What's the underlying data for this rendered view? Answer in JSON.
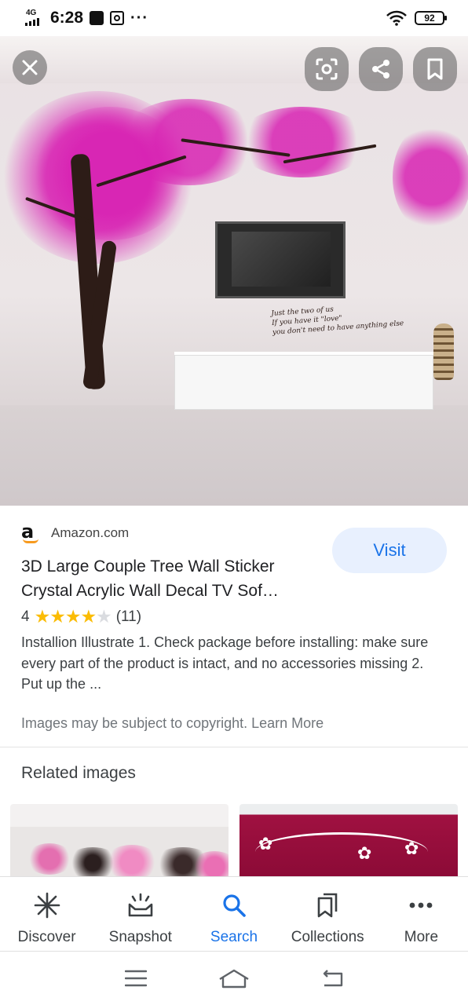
{
  "status_bar": {
    "network": "4G",
    "time": "6:28",
    "notification_dots": "···",
    "battery": "92"
  },
  "hero": {
    "tv_quote_lines": [
      "Just the two of us",
      "If you have it \"love\"",
      "you don't need to have anything else"
    ]
  },
  "result": {
    "source": "Amazon.com",
    "visit_label": "Visit",
    "title": "3D Large Couple Tree Wall Sticker Crystal Acrylic Wall Decal TV Sof…",
    "rating_value": "4",
    "rating_stars": 4,
    "rating_count": "(11)",
    "description": "Installion Illustrate 1. Check package before installing: make sure every part of the product is intact, and no accessories missing 2. Put up the ...",
    "copyright": "Images may be subject to copyright. Learn More"
  },
  "related": {
    "title": "Related images"
  },
  "bottom_nav": {
    "discover": "Discover",
    "snapshot": "Snapshot",
    "search": "Search",
    "collections": "Collections",
    "more": "More"
  },
  "colors": {
    "accent": "#1a73e8",
    "visit_bg": "#e8f0fe",
    "star": "#fbbc04",
    "canopy_pink": "#d822b3"
  },
  "icons": [
    "close-icon",
    "lens-icon",
    "share-icon",
    "bookmark-icon",
    "amazon-logo",
    "discover-icon",
    "snapshot-icon",
    "search-icon",
    "collections-icon",
    "more-icon",
    "recents-icon",
    "home-icon",
    "back-icon"
  ]
}
